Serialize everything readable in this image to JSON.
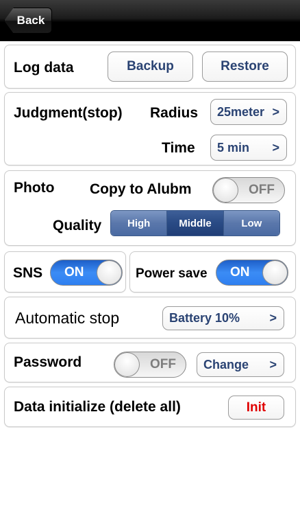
{
  "nav": {
    "back_label": "Back"
  },
  "log_data": {
    "label": "Log data",
    "backup_label": "Backup",
    "restore_label": "Restore"
  },
  "judgment": {
    "label": "Judgment(stop)",
    "radius_label": "Radius",
    "radius_value": "25meter",
    "time_label": "Time",
    "time_value": "5 min"
  },
  "photo": {
    "label": "Photo",
    "copy_label": "Copy to Alubm",
    "copy_toggle": "OFF",
    "quality_label": "Quality",
    "quality_options": [
      "High",
      "Middle",
      "Low"
    ],
    "quality_selected": "Middle"
  },
  "sns": {
    "label": "SNS",
    "toggle": "ON"
  },
  "power_save": {
    "label": "Power save",
    "toggle": "ON"
  },
  "automatic_stop": {
    "label": "Automatic stop",
    "value": "Battery 10%"
  },
  "password": {
    "label": "Password",
    "toggle": "OFF",
    "change_label": "Change"
  },
  "data_initialize": {
    "label": "Data initialize (delete all)",
    "init_label": "Init"
  },
  "chevron": ">"
}
